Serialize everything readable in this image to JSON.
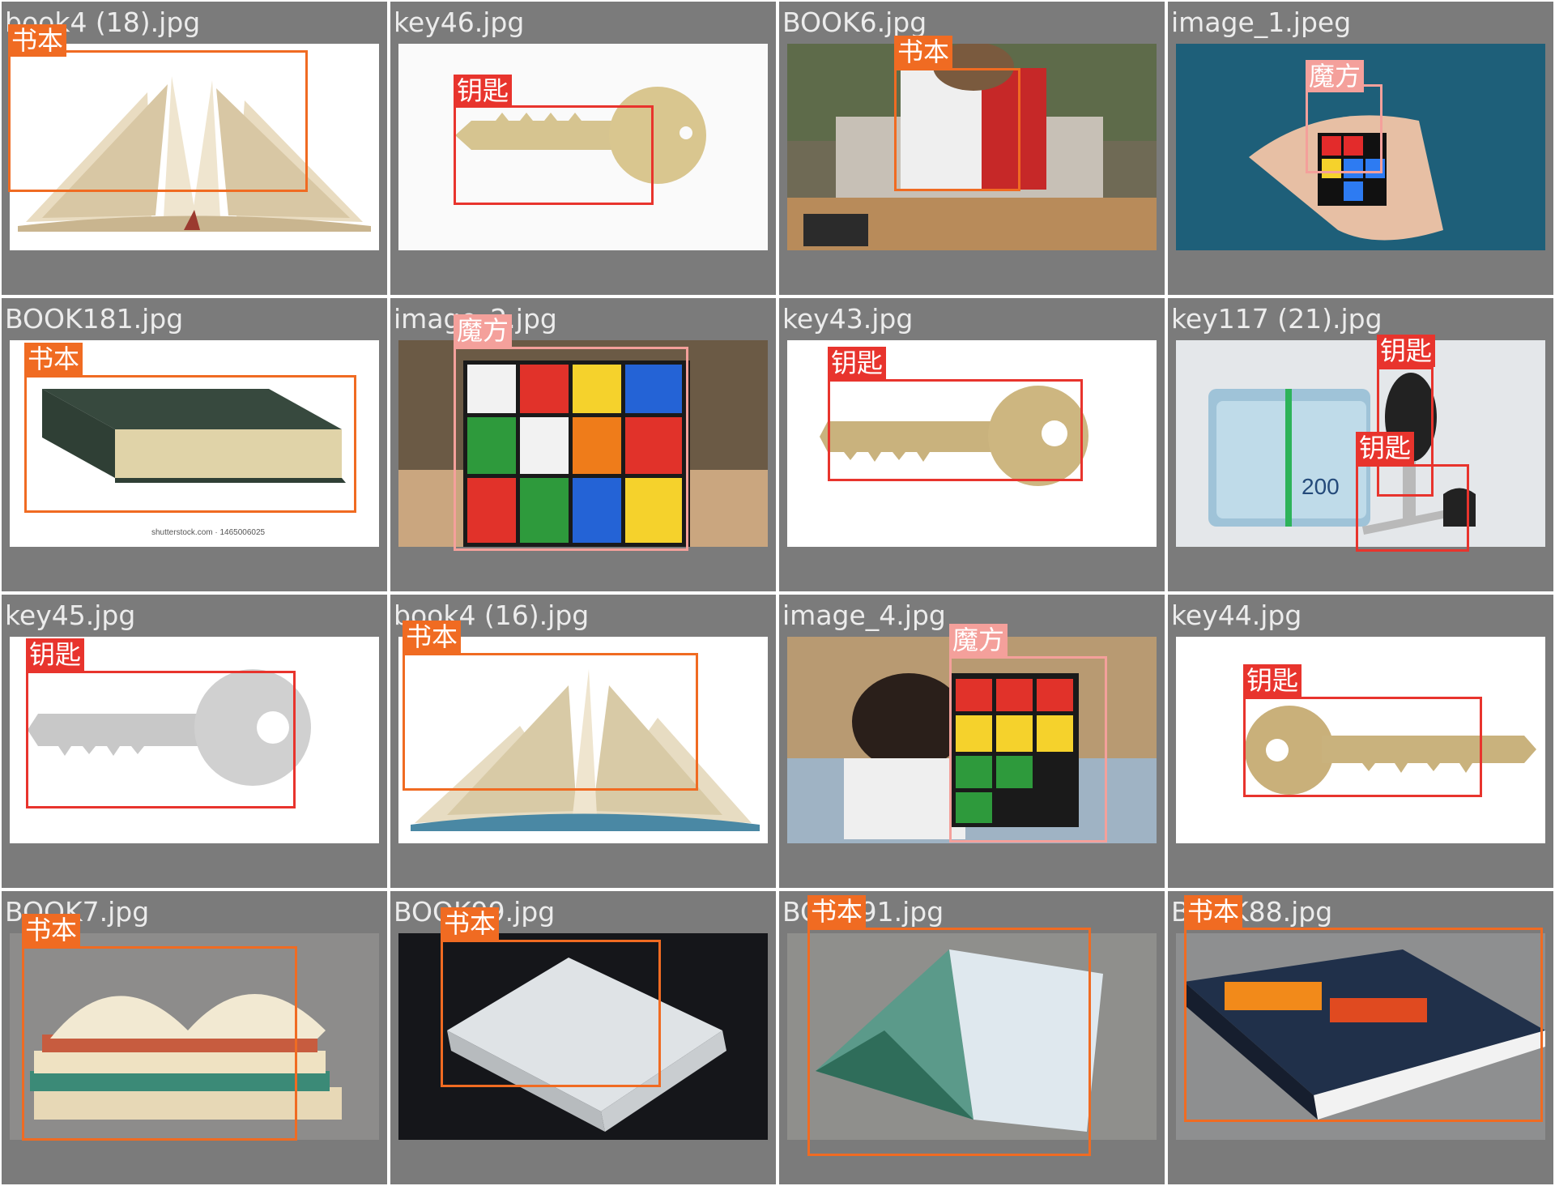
{
  "labels": {
    "book": "书本",
    "key": "钥匙",
    "cube": "魔方"
  },
  "label_colors": {
    "book": "#f06b22",
    "key": "#e8342d",
    "cube": "#f4a09b"
  },
  "cells": [
    {
      "file": "book4 (18).jpg",
      "scene": "open-book-white",
      "detections": [
        {
          "cls": "book",
          "text": "书本"
        }
      ]
    },
    {
      "file": "key46.jpg",
      "scene": "gold-key-white",
      "detections": [
        {
          "cls": "key",
          "text": "钥匙"
        }
      ]
    },
    {
      "file": "BOOK6.jpg",
      "scene": "person-reading",
      "detections": [
        {
          "cls": "book",
          "text": "书本"
        }
      ]
    },
    {
      "file": "image_1.jpeg",
      "scene": "cube-in-hand-blue",
      "detections": [
        {
          "cls": "cube",
          "text": "魔方"
        }
      ]
    },
    {
      "file": "BOOK181.jpg",
      "scene": "closed-green-book",
      "detections": [
        {
          "cls": "book",
          "text": "书本"
        }
      ]
    },
    {
      "file": "image_2.jpg",
      "scene": "giant-cube-room",
      "detections": [
        {
          "cls": "cube",
          "text": "魔方"
        }
      ]
    },
    {
      "file": "key43.jpg",
      "scene": "brass-key-white",
      "detections": [
        {
          "cls": "key",
          "text": "钥匙"
        }
      ]
    },
    {
      "file": "key117 (21).jpg",
      "scene": "money-and-car-key",
      "detections": [
        {
          "cls": "key",
          "text": "钥匙"
        },
        {
          "cls": "key",
          "text": "钥匙"
        }
      ]
    },
    {
      "file": "key45.jpg",
      "scene": "silver-key-white",
      "detections": [
        {
          "cls": "key",
          "text": "钥匙"
        }
      ]
    },
    {
      "file": "book4 (16).jpg",
      "scene": "open-book-fan",
      "detections": [
        {
          "cls": "book",
          "text": "书本"
        }
      ]
    },
    {
      "file": "image_4.jpg",
      "scene": "cube-blurred-person",
      "detections": [
        {
          "cls": "cube",
          "text": "魔方"
        }
      ]
    },
    {
      "file": "key44.jpg",
      "scene": "gold-key-left",
      "detections": [
        {
          "cls": "key",
          "text": "钥匙"
        }
      ]
    },
    {
      "file": "BOOK7.jpg",
      "scene": "stacked-books",
      "detections": [
        {
          "cls": "book",
          "text": "书本"
        }
      ]
    },
    {
      "file": "BOOK99.jpg",
      "scene": "white-book-dark",
      "detections": [
        {
          "cls": "book",
          "text": "书本"
        }
      ]
    },
    {
      "file": "BOOK91.jpg",
      "scene": "magazine-open",
      "detections": [
        {
          "cls": "book",
          "text": "书本"
        }
      ]
    },
    {
      "file": "BOOK88.jpg",
      "scene": "thick-book-gray",
      "detections": [
        {
          "cls": "book",
          "text": "书本"
        }
      ]
    }
  ]
}
